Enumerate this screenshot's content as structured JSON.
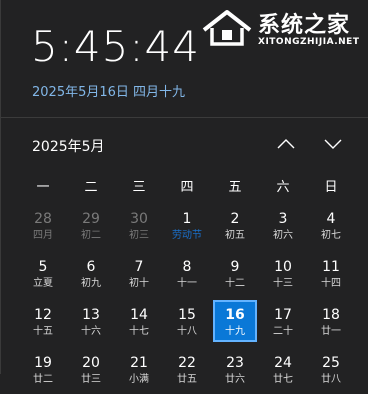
{
  "clock": {
    "time": "5:45:44",
    "date_line": "2025年5月16日 四月十九"
  },
  "calendar": {
    "month_label": "2025年5月",
    "weekdays": [
      "一",
      "二",
      "三",
      "四",
      "五",
      "六",
      "日"
    ],
    "days": [
      {
        "num": "28",
        "lunar": "四月",
        "other": true
      },
      {
        "num": "29",
        "lunar": "初二",
        "other": true
      },
      {
        "num": "30",
        "lunar": "初三",
        "other": true
      },
      {
        "num": "1",
        "lunar": "劳动节",
        "holiday": true
      },
      {
        "num": "2",
        "lunar": "初五"
      },
      {
        "num": "3",
        "lunar": "初六"
      },
      {
        "num": "4",
        "lunar": "初七"
      },
      {
        "num": "5",
        "lunar": "立夏"
      },
      {
        "num": "6",
        "lunar": "初九"
      },
      {
        "num": "7",
        "lunar": "初十"
      },
      {
        "num": "8",
        "lunar": "十一"
      },
      {
        "num": "9",
        "lunar": "十二"
      },
      {
        "num": "10",
        "lunar": "十三"
      },
      {
        "num": "11",
        "lunar": "十四"
      },
      {
        "num": "12",
        "lunar": "十五"
      },
      {
        "num": "13",
        "lunar": "十六"
      },
      {
        "num": "14",
        "lunar": "十七"
      },
      {
        "num": "15",
        "lunar": "十八"
      },
      {
        "num": "16",
        "lunar": "十九",
        "today": true
      },
      {
        "num": "17",
        "lunar": "二十"
      },
      {
        "num": "18",
        "lunar": "廿一"
      },
      {
        "num": "19",
        "lunar": "廿二"
      },
      {
        "num": "20",
        "lunar": "廿三"
      },
      {
        "num": "21",
        "lunar": "小满"
      },
      {
        "num": "22",
        "lunar": "廿五"
      },
      {
        "num": "23",
        "lunar": "廿六"
      },
      {
        "num": "24",
        "lunar": "廿七"
      },
      {
        "num": "25",
        "lunar": "廿八"
      }
    ]
  },
  "watermark": {
    "title": "系统之家",
    "subtitle": "XITONGZHIJIA.NET"
  },
  "colors": {
    "background": "#222223",
    "accent": "#0a78d7",
    "link": "#82b7e8",
    "holiday": "#1a6fc9"
  },
  "icons": {
    "prev": "chevron-up-icon",
    "next": "chevron-down-icon",
    "logo": "house-logo-icon"
  }
}
